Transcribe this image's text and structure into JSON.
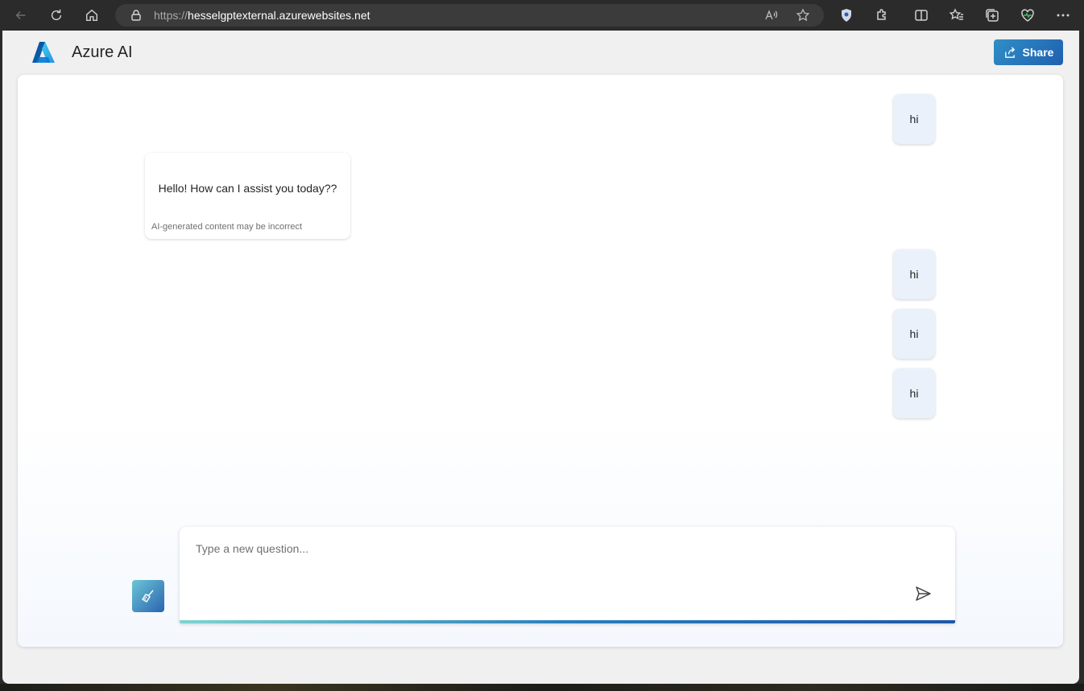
{
  "browser": {
    "url_protocol": "https://",
    "url_host": "hesselgptexternal.azurewebsites.net"
  },
  "header": {
    "title": "Azure AI",
    "share_label": "Share"
  },
  "chat": {
    "messages": [
      {
        "role": "user",
        "text": "hi"
      },
      {
        "role": "assistant",
        "text": "Hello! How can I assist you today??",
        "disclaimer": "AI-generated content may be incorrect"
      },
      {
        "role": "user",
        "text": "hi"
      },
      {
        "role": "user",
        "text": "hi"
      },
      {
        "role": "user",
        "text": "hi"
      }
    ]
  },
  "composer": {
    "placeholder": "Type a new question..."
  }
}
